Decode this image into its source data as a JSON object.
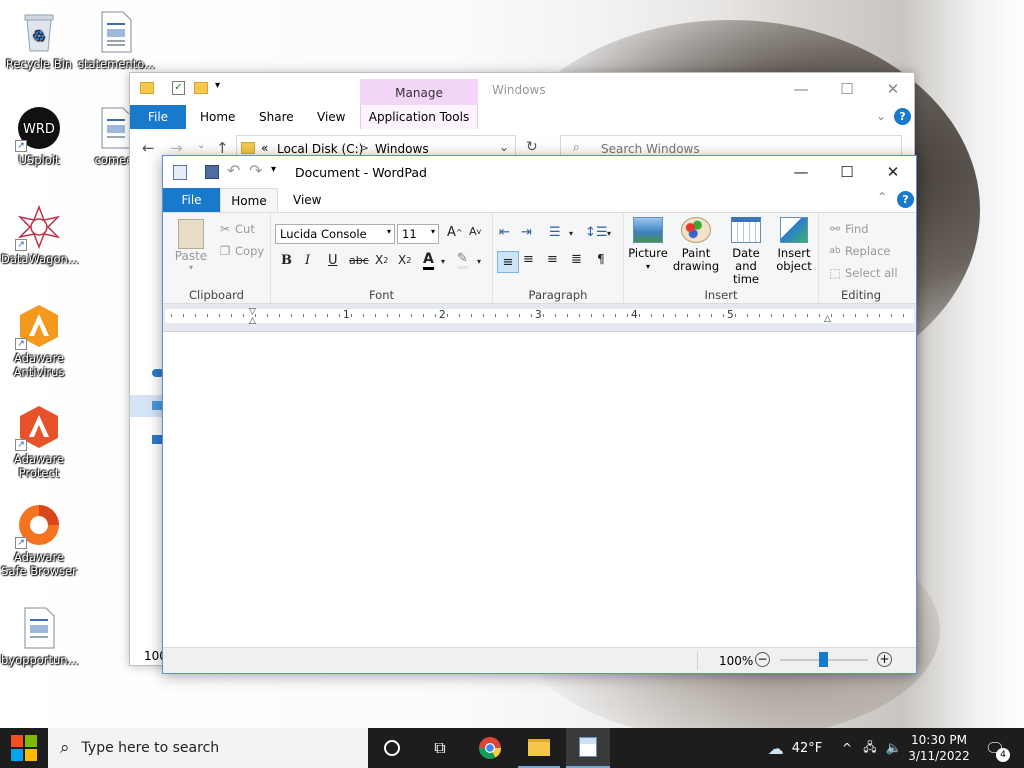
{
  "desktop": {
    "icons": [
      {
        "label": "Recycle Bin"
      },
      {
        "label": "statemento..."
      },
      {
        "label": "USploit"
      },
      {
        "label": "comeef"
      },
      {
        "label": "DataWagon..."
      },
      {
        "label": "Adaware Antivirus"
      },
      {
        "label": "Adaware Protect"
      },
      {
        "label": "Adaware Safe Browser"
      },
      {
        "label": "byopportun..."
      }
    ]
  },
  "explorer": {
    "manage_label": "Manage",
    "title": "Windows",
    "tabs": [
      "File",
      "Home",
      "Share",
      "View",
      "Application Tools"
    ],
    "breadcrumb": [
      "«",
      "Local Disk (C:)",
      ">",
      "Windows"
    ],
    "search_placeholder": "Search Windows",
    "status_zoom": "100"
  },
  "wordpad": {
    "title": "Document - WordPad",
    "tabs": [
      "File",
      "Home",
      "View"
    ],
    "clipboard": {
      "paste": "Paste",
      "cut": "Cut",
      "copy": "Copy",
      "label": "Clipboard"
    },
    "font": {
      "name": "Lucida Console",
      "size": "11",
      "label": "Font"
    },
    "paragraph": {
      "label": "Paragraph"
    },
    "insert": {
      "picture": "Picture",
      "paint1": "Paint",
      "paint2": "drawing",
      "date1": "Date and",
      "date2": "time",
      "obj1": "Insert",
      "obj2": "object",
      "label": "Insert"
    },
    "editing": {
      "find": "Find",
      "replace": "Replace",
      "select_all": "Select all",
      "label": "Editing"
    },
    "ruler_numbers": [
      "1",
      "2",
      "3",
      "4",
      "5"
    ],
    "zoom": "100%"
  },
  "taskbar": {
    "search_placeholder": "Type here to search",
    "weather": "42°F",
    "time": "10:30 PM",
    "date": "3/11/2022",
    "notifications": "4"
  },
  "colors": {
    "accent": "#1979ca",
    "taskbar": "#1d1d1d",
    "manage_tab": "#f3d6f7"
  }
}
